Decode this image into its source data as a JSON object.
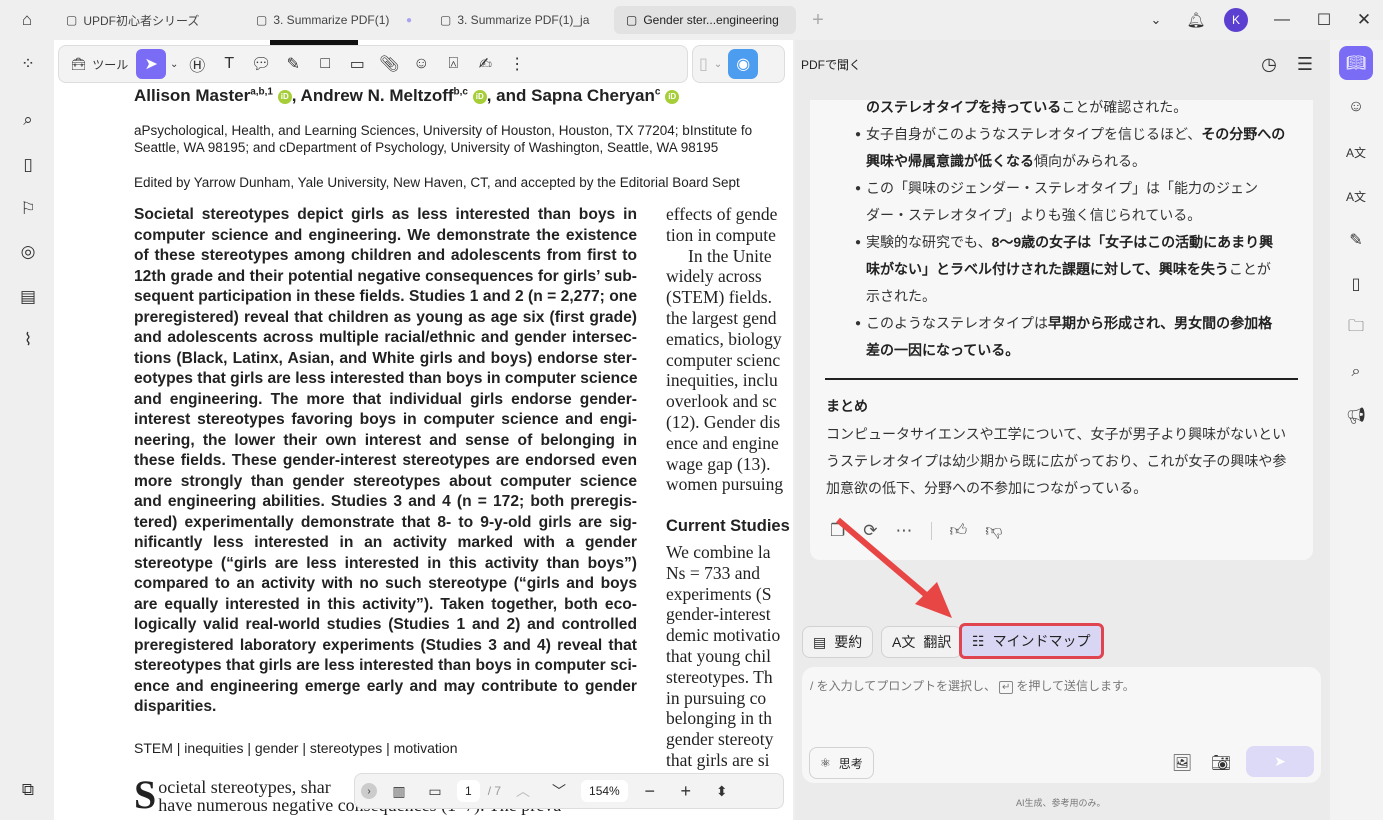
{
  "tabs": [
    {
      "label": "UPDF初心者シリーズ"
    },
    {
      "label": "3. Summarize PDF(1)"
    },
    {
      "label": "3. Summarize PDF(1)_ja"
    },
    {
      "label": "Gender ster...engineering"
    }
  ],
  "window": {
    "avatar": "K"
  },
  "toolbar": {
    "tools_label": "ツール"
  },
  "pdf": {
    "authors": {
      "a1": "Allison Master",
      "s1": "a,b,1",
      "a2": ", Andrew N. Meltzoff",
      "s2": "b,c",
      "a3": ", and Sapna Cheryan",
      "s3": "c"
    },
    "affiliation": [
      "aPsychological, Health, and Learning Sciences, University of Houston, Houston, TX 77204; bInstitute fo",
      "Seattle, WA 98195; and cDepartment of Psychology, University of Washington, Seattle, WA 98195"
    ],
    "edited": "Edited by Yarrow Dunham, Yale University, New Haven, CT, and accepted by the Editorial Board Sept",
    "abstract": [
      "Societal stereotypes depict girls as less interested than boys in",
      "computer science and engineering. We demonstrate the existence",
      "of these stereotypes among children and adolescents from first to",
      "12th grade and their potential negative consequences for girls’ sub-",
      "sequent participation in these fields. Studies 1 and 2 (n = 2,277; one",
      "preregistered) reveal that children as young as age six (first grade)",
      "and adolescents across multiple racial/ethnic and gender intersec-",
      "tions (Black, Latinx, Asian, and White girls and boys) endorse ster-",
      "eotypes that girls are less interested than boys in computer science",
      "and engineering. The more that individual girls endorse gender-",
      "interest stereotypes favoring boys in computer science and engi-",
      "neering, the lower their own interest and sense of belonging in",
      "these fields. These gender-interest stereotypes are endorsed even",
      "more strongly than gender stereotypes about computer science",
      "and engineering abilities. Studies 3 and 4 (n = 172; both preregis-",
      "tered) experimentally demonstrate that 8- to 9-y-old girls are sig-",
      "nificantly less interested in an activity marked with a gender",
      "stereotype (“girls are less interested in this activity than boys”)",
      "compared to an activity with no such stereotype (“girls and boys",
      "are equally interested in this activity”). Taken together, both eco-",
      "logically valid real-world studies (Studies 1 and 2) and controlled",
      "preregistered laboratory experiments (Studies 3 and 4) reveal that",
      "stereotypes that girls are less interested than boys in computer sci-",
      "ence and engineering emerge early and may contribute to gender",
      "disparities."
    ],
    "column2": [
      "effects of gende",
      "tion in compute",
      "  In the Unite",
      "widely across",
      "(STEM) fields.",
      "the largest gend",
      "ematics, biology",
      "computer scienc",
      "inequities, inclu",
      "overlook and sc",
      "(12). Gender dis",
      "ence and engine",
      "wage gap (13).",
      "women pursuing"
    ],
    "current_studies": "Current Studies",
    "column3": [
      "We combine la",
      "Ns = 733 and",
      "experiments (S",
      "gender-interest",
      "demic motivatio",
      "that young chil",
      "stereotypes. Th",
      "in pursuing co",
      "belonging in th",
      "gender stereoty",
      "that girls are si"
    ],
    "keywords": "STEM | inequities | gender | stereotypes | motivation",
    "body_drop": "S",
    "body_line1": "ocietal stereotypes, shar",
    "body_line2": "have numerous negative consequences (1–7). The preva-"
  },
  "pagebar": {
    "page": "1",
    "total": "/ 7",
    "zoom": "154%"
  },
  "chat": {
    "title": "PDFで聞く",
    "lines": [
      {
        "parts": [
          {
            "b": true,
            "t": "のステレオタイプを持っている"
          },
          {
            "t": "ことが確認された。"
          }
        ]
      },
      {
        "bullet": true,
        "parts": [
          {
            "t": "女子自身がこのようなステレオタイプを信じるほど、"
          },
          {
            "b": true,
            "t": "その分野への"
          }
        ]
      },
      {
        "parts": [
          {
            "b": true,
            "t": "興味や帰属意識が低くなる"
          },
          {
            "t": "傾向がみられる。"
          }
        ]
      },
      {
        "bullet": true,
        "parts": [
          {
            "t": "この「興味のジェンダー・ステレオタイプ」は「能力のジェン"
          }
        ]
      },
      {
        "parts": [
          {
            "t": "ダー・ステレオタイプ」よりも強く信じられている。"
          }
        ]
      },
      {
        "bullet": true,
        "parts": [
          {
            "t": "実験的な研究でも、"
          },
          {
            "b": true,
            "t": "8〜9歳の女子は「女子はこの活動にあまり興"
          }
        ]
      },
      {
        "parts": [
          {
            "b": true,
            "t": "味がない」とラベル付けされた課題に対して、興味を失う"
          },
          {
            "t": "ことが"
          }
        ]
      },
      {
        "parts": [
          {
            "t": "示された。"
          }
        ]
      },
      {
        "bullet": true,
        "parts": [
          {
            "t": "このようなステレオタイプは"
          },
          {
            "b": true,
            "t": "早期から形成され、男女間の参加格"
          }
        ]
      },
      {
        "parts": [
          {
            "b": true,
            "t": "差の一因になっている。"
          }
        ]
      }
    ],
    "summary_heading": "まとめ",
    "summary": [
      "コンピュータサイエンスや工学について、女子が男子より興味がないとい",
      "うステレオタイプは幼少期から既に広がっており、これが女子の興味や参",
      "加意欲の低下、分野への不参加につながっている。"
    ],
    "quick": {
      "summarize": "要約",
      "translate": "翻訳",
      "mindmap": "マインドマップ"
    },
    "placeholder_a": "/ を入力してプロンプトを選択し、",
    "placeholder_b": "を押して送信します。",
    "think": "思考",
    "footer": "AI生成、参考用のみ。",
    "accent": "#7b6cf6",
    "highlight": "#e0454f"
  }
}
